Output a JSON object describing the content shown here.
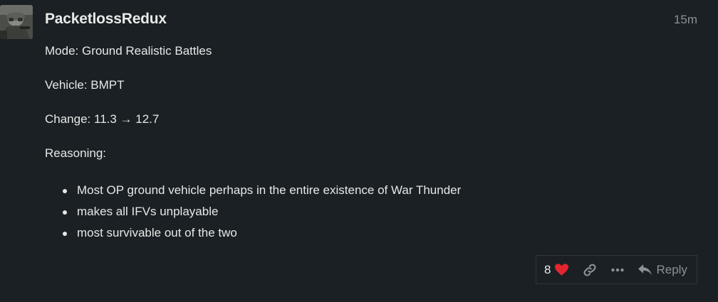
{
  "post": {
    "username": "PacketlossRedux",
    "timestamp": "15m",
    "paragraphs": {
      "mode": "Mode: Ground Realistic Battles",
      "vehicle": "Vehicle: BMPT",
      "change": "Change: 11.3 → 12.7",
      "reasoning": "Reasoning:"
    },
    "bullets": [
      "Most OP ground vehicle perhaps in the entire existence of War Thunder",
      "makes all IFVs unplayable",
      "most survivable out of the two"
    ]
  },
  "actions": {
    "like_count": "8",
    "like_icon": "heart-icon",
    "copy_link_icon": "link-icon",
    "more_icon": "ellipsis-icon",
    "reply_icon": "reply-arrow-icon",
    "reply_label": "Reply"
  },
  "colors": {
    "background": "#1a2023",
    "text": "#e6e8e8",
    "muted": "#8b9397",
    "heart": "#e4252f"
  }
}
